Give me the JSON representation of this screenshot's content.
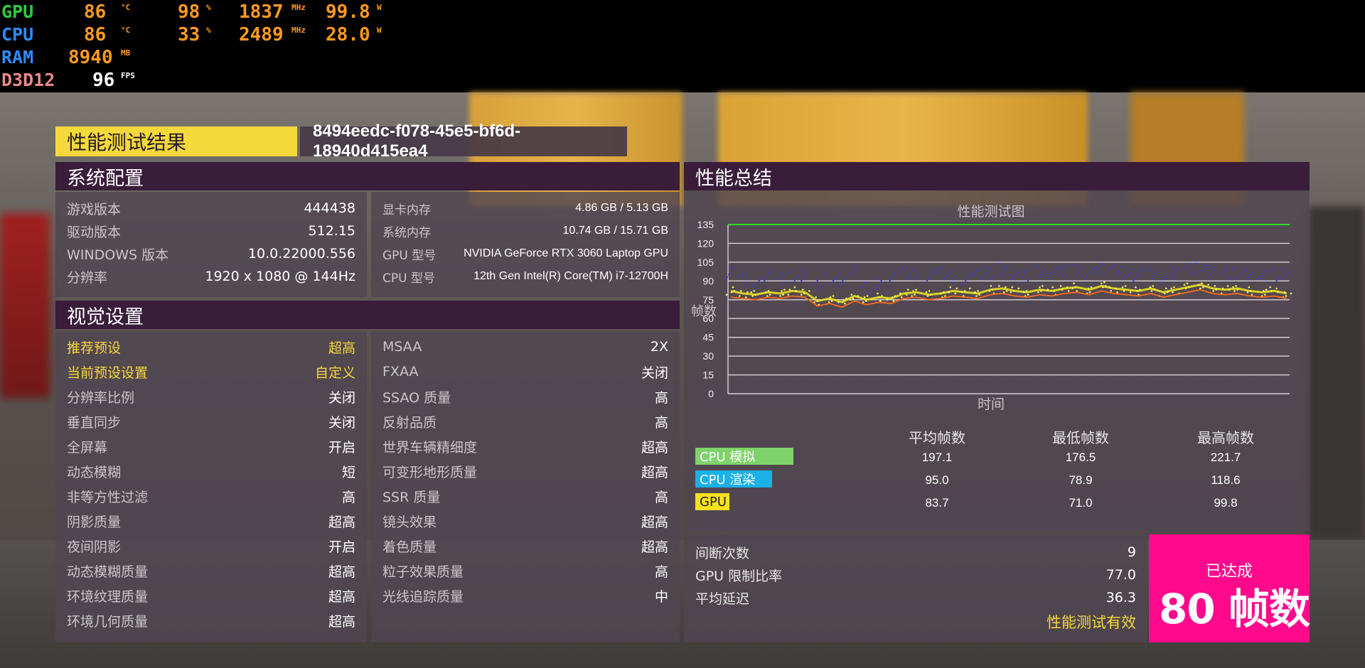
{
  "osd": [
    {
      "label": "GPU",
      "label_color": "#2ecc40",
      "temp": "86",
      "temp_unit": "°C",
      "load": "98",
      "load_unit": "%",
      "clock": "1837",
      "clock_unit": "MHz",
      "power": "99.8",
      "power_unit": "W"
    },
    {
      "label": "CPU",
      "label_color": "#2d8cff",
      "temp": "86",
      "temp_unit": "°C",
      "load": "33",
      "load_unit": "%",
      "clock": "2489",
      "clock_unit": "MHz",
      "power": "28.0",
      "power_unit": "W"
    },
    {
      "label": "RAM",
      "label_color": "#2d8cff",
      "value": "8940",
      "unit": "MB"
    },
    {
      "label": "D3D12",
      "label_color": "#e88a8a",
      "value": "96",
      "unit": "FPS"
    }
  ],
  "header": {
    "title": "性能测试结果",
    "run_id": "8494eedc-f078-45e5-bf6d-18940d415ea4"
  },
  "system": {
    "title": "系统配置",
    "left": [
      {
        "k": "游戏版本",
        "v": "444438"
      },
      {
        "k": "驱动版本",
        "v": "512.15"
      },
      {
        "k": "WINDOWS 版本",
        "v": "10.0.22000.556"
      },
      {
        "k": "分辨率",
        "v": "1920 x 1080 @ 144Hz"
      }
    ],
    "right": [
      {
        "k": "显卡内存",
        "v": "4.86 GB / 5.13 GB"
      },
      {
        "k": "系统内存",
        "v": "10.74 GB / 15.71 GB"
      },
      {
        "k": "GPU 型号",
        "v": "NVIDIA GeForce RTX 3060 Laptop GPU"
      },
      {
        "k": "CPU 型号",
        "v": "12th Gen Intel(R) Core(TM) i7-12700H"
      }
    ]
  },
  "visual": {
    "title": "视觉设置",
    "left": [
      {
        "k": "推荐预设",
        "v": "超高",
        "hl": true
      },
      {
        "k": "当前预设设置",
        "v": "自定义",
        "hl": true
      },
      {
        "k": "分辨率比例",
        "v": "关闭"
      },
      {
        "k": "垂直同步",
        "v": "关闭"
      },
      {
        "k": "全屏幕",
        "v": "开启"
      },
      {
        "k": "动态模糊",
        "v": "短"
      },
      {
        "k": "非等方性过滤",
        "v": "高"
      },
      {
        "k": "阴影质量",
        "v": "超高"
      },
      {
        "k": "夜间阴影",
        "v": "开启"
      },
      {
        "k": "动态模糊质量",
        "v": "超高"
      },
      {
        "k": "环境纹理质量",
        "v": "超高"
      },
      {
        "k": "环境几何质量",
        "v": "超高"
      }
    ],
    "right": [
      {
        "k": "MSAA",
        "v": "2X"
      },
      {
        "k": "FXAA",
        "v": "关闭"
      },
      {
        "k": "SSAO 质量",
        "v": "高"
      },
      {
        "k": "反射品质",
        "v": "高"
      },
      {
        "k": "世界车辆精细度",
        "v": "超高"
      },
      {
        "k": "可变形地形质量",
        "v": "超高"
      },
      {
        "k": "SSR 质量",
        "v": "高"
      },
      {
        "k": "镜头效果",
        "v": "超高"
      },
      {
        "k": "着色质量",
        "v": "超高"
      },
      {
        "k": "粒子效果质量",
        "v": "高"
      },
      {
        "k": "光线追踪质量",
        "v": "中"
      }
    ]
  },
  "summary": {
    "title": "性能总结",
    "stats_headers": [
      "平均帧数",
      "最低帧数",
      "最高帧数"
    ],
    "stats": [
      {
        "name": "CPU 模拟",
        "color": "#7fd36a",
        "avg": "197.1",
        "min": "176.5",
        "max": "221.7"
      },
      {
        "name": "CPU 渲染",
        "color": "#1ab0e8",
        "avg": "95.0",
        "min": "78.9",
        "max": "118.6"
      },
      {
        "name": "GPU",
        "color": "#f5e21e",
        "avg": "83.7",
        "min": "71.0",
        "max": "99.8"
      }
    ],
    "bottom": [
      {
        "k": "间断次数",
        "v": "9"
      },
      {
        "k": "GPU 限制比率",
        "v": "77.0"
      },
      {
        "k": "平均延迟",
        "v": "36.3"
      }
    ],
    "valid_text": "性能测试有效",
    "badge_line1": "已达成",
    "badge_line2": "80 帧数"
  },
  "chart_data": {
    "type": "line",
    "title": "性能测试图",
    "xlabel": "时间",
    "ylabel": "帧数",
    "ylim": [
      0,
      135
    ],
    "yticks": [
      0,
      15,
      30,
      45,
      60,
      75,
      90,
      105,
      120,
      135
    ],
    "target_line": 135,
    "target_color": "#22e020",
    "series": [
      {
        "name": "CPU 渲染",
        "color": "#3a3ad8",
        "values": [
          96,
          92,
          90,
          94,
          91,
          93,
          95,
          88,
          92,
          90,
          97,
          84,
          89,
          92,
          96,
          95,
          93,
          97,
          94,
          92,
          96,
          95,
          99,
          94,
          95,
          97,
          96,
          98,
          99,
          97,
          100,
          98,
          96,
          95,
          97,
          94,
          96,
          99,
          101,
          98,
          96,
          97,
          95,
          93,
          95,
          96
        ]
      },
      {
        "name": "GPU",
        "color": "#e8e020",
        "values": [
          82,
          80,
          79,
          81,
          80,
          82,
          81,
          74,
          76,
          73,
          78,
          75,
          77,
          76,
          80,
          81,
          79,
          80,
          82,
          81,
          80,
          83,
          84,
          82,
          81,
          83,
          82,
          84,
          85,
          83,
          86,
          84,
          83,
          82,
          84,
          81,
          83,
          85,
          87,
          84,
          83,
          84,
          82,
          81,
          82,
          80
        ]
      },
      {
        "name": "最低",
        "color": "#ff6a1a",
        "values": [
          77,
          76,
          75,
          77,
          76,
          78,
          77,
          70,
          72,
          69,
          74,
          71,
          73,
          72,
          76,
          77,
          75,
          76,
          78,
          77,
          76,
          79,
          80,
          78,
          77,
          79,
          78,
          80,
          81,
          79,
          82,
          80,
          79,
          78,
          80,
          77,
          79,
          81,
          83,
          80,
          79,
          80,
          78,
          77,
          78,
          76
        ]
      }
    ]
  }
}
